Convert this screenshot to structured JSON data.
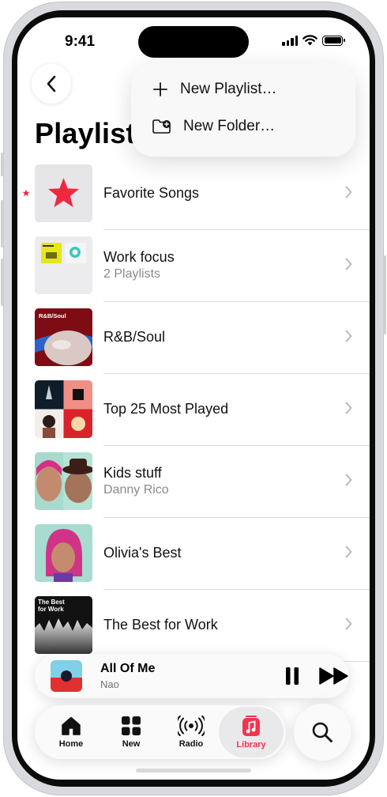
{
  "status_bar": {
    "time": "9:41"
  },
  "header": {
    "title": "Playlist"
  },
  "menu": {
    "items": [
      {
        "label": "New Playlist…",
        "icon": "plus-icon"
      },
      {
        "label": "New Folder…",
        "icon": "folder-plus-icon"
      }
    ]
  },
  "playlists": [
    {
      "title": "Favorite Songs",
      "subtitle": ""
    },
    {
      "title": "Work focus",
      "subtitle": "2 Playlists"
    },
    {
      "title": "R&B/Soul",
      "subtitle": "",
      "art_label": "R&B/Soul"
    },
    {
      "title": "Top 25 Most Played",
      "subtitle": ""
    },
    {
      "title": "Kids stuff",
      "subtitle": "Danny Rico"
    },
    {
      "title": "Olivia's Best",
      "subtitle": ""
    },
    {
      "title": "The Best for Work",
      "subtitle": "",
      "art_label": "The Best for Work"
    }
  ],
  "mini_player": {
    "title": "All Of Me",
    "artist": "Nao"
  },
  "tab_bar": {
    "tabs": [
      {
        "label": "Home",
        "icon": "house-icon"
      },
      {
        "label": "New",
        "icon": "grid-icon"
      },
      {
        "label": "Radio",
        "icon": "radio-waves-icon"
      },
      {
        "label": "Library",
        "icon": "music-note-icon",
        "active": true
      }
    ]
  },
  "colors": {
    "accent": "#f5334f",
    "star": "#f0273f"
  }
}
